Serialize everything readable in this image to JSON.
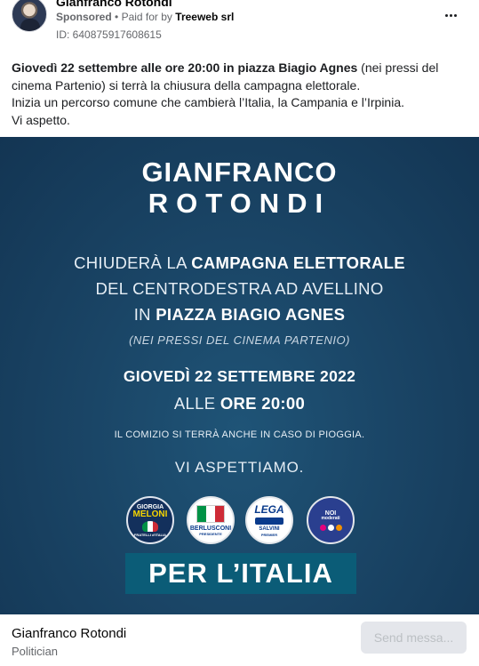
{
  "header": {
    "advertiser_name": "Gianfranco Rotondi",
    "sponsored_label": "Sponsored",
    "separator": "•",
    "paid_for_prefix": "Paid for by",
    "payer": "Treeweb srl",
    "ad_id": "ID: 640875917608615",
    "more_icon": "more-horizontal-icon"
  },
  "post": {
    "line1_bold": "Giovedì 22 settembre alle ore 20:00 in piazza Biagio Agnes",
    "line1_rest": " (nei pressi del cinema Partenio) si terrà la chiusura della campagna elettorale.",
    "line2": "Inizia un percorso comune che cambierà l’Italia, la Campania e l’Irpinia.",
    "line3": "Vi aspetto."
  },
  "creative": {
    "name_first": "GIANFRANCO",
    "name_last": "ROTONDI",
    "l1_pre": "CHIUDERÀ LA ",
    "l1_bold": "CAMPAGNA ELETTORALE",
    "l2": "DEL CENTRODESTRA AD AVELLINO",
    "l3_pre": "IN ",
    "l3_bold": "PIAZZA BIAGIO AGNES",
    "l4": "(NEI PRESSI DEL CINEMA PARTENIO)",
    "l5": "GIOVEDÌ 22 SETTEMBRE 2022",
    "l6_pre": "ALLE ",
    "l6_bold": "ORE 20:00",
    "l7": "IL COMIZIO SI TERRÀ ANCHE IN CASO DI PIOGGIA.",
    "l8": "VI ASPETTIAMO.",
    "logos": {
      "fdi_1": "GIORGIA",
      "fdi_2": "MELONI",
      "fdi_3": "FRATELLI d'ITALIA",
      "fi_1": "BERLUSCONI",
      "fi_2": "PRESIDENTE",
      "lega_1": "LEGA",
      "lega_2": "SALVINI",
      "lega_3": "PREMIER",
      "nm_1": "NOI",
      "nm_2": "moderati"
    },
    "slogan": "PER L’ITALIA",
    "colors": {
      "background": "#1a4566",
      "slogan_band": "#0b5c77"
    }
  },
  "footer": {
    "page_name": "Gianfranco Rotondi",
    "page_category": "Politician",
    "send_button": "Send messa..."
  }
}
